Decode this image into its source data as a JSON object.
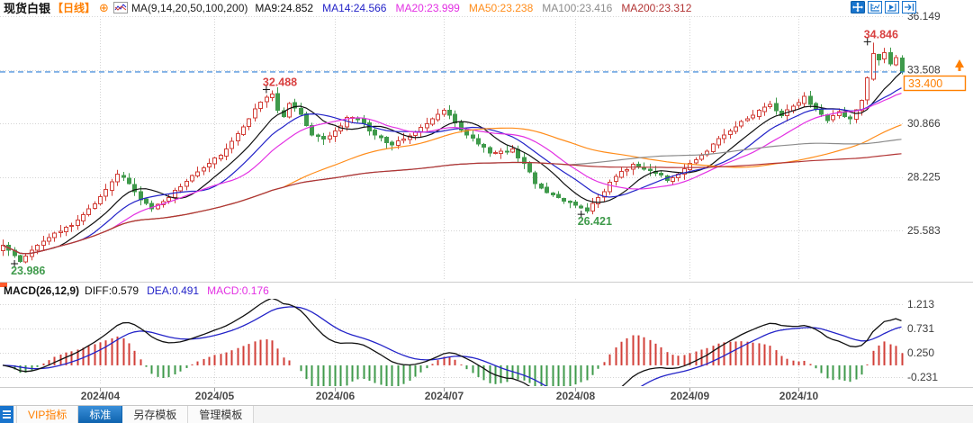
{
  "header": {
    "symbol": "现货白银",
    "period": "【日线】",
    "ma_group": "MA(9,14,20,50,100,200)",
    "ma_values": [
      {
        "key": "ma9",
        "label": "MA9:24.852"
      },
      {
        "key": "ma14",
        "label": "MA14:24.566"
      },
      {
        "key": "ma20",
        "label": "MA20:23.999"
      },
      {
        "key": "ma50",
        "label": "MA50:23.238"
      },
      {
        "key": "ma100",
        "label": "MA100:23.416"
      },
      {
        "key": "ma200",
        "label": "MA200:23.312"
      }
    ]
  },
  "macd_header": {
    "name": "MACD(26,12,9)",
    "values": [
      {
        "key": "diff",
        "label": "DIFF:0.579"
      },
      {
        "key": "dea",
        "label": "DEA:0.491"
      },
      {
        "key": "macd",
        "label": "MACD:0.176"
      }
    ]
  },
  "price_box": "33.400",
  "icons": {
    "header": [
      "target-circle-icon",
      "mini-chart-icon"
    ],
    "toolbar": [
      "move-crosshair-icon",
      "axis-left-scale-icon",
      "axis-right-scale-icon",
      "shift-right-icon"
    ],
    "tabbar": [
      "menu-grid-icon"
    ],
    "axis": [
      "up-arrow-icon"
    ]
  },
  "tabs": {
    "items": [
      {
        "label": "VIP指标",
        "style": "vip"
      },
      {
        "label": "标准",
        "active": true
      },
      {
        "label": "另存模板"
      },
      {
        "label": "管理模板"
      }
    ]
  },
  "colors": {
    "up": "#d23f38",
    "down": "#3f9a4b",
    "ma9": "#111111",
    "ma14": "#2323c8",
    "ma20": "#e331e3",
    "ma50": "#ff8c1a",
    "ma100": "#8c8c8c",
    "ma200": "#b23434",
    "diff": "#111111",
    "dea": "#2323c8",
    "macd": "#e331e3",
    "accent_orange": "#ff7f00",
    "accent_blue": "#1874cd",
    "price_line": "#2f7fd6",
    "label_red": "#d94040",
    "label_green": "#3f9a4b",
    "grid": "#d4d4d4",
    "axis_text": "#3c3c3c",
    "date_text": "#4a4a4a"
  },
  "chart_data": {
    "type": "candlestick",
    "title": "现货白银",
    "period": "日线",
    "panes": [
      "price+MA(9,14,20,50,100,200)",
      "MACD(26,12,9)"
    ],
    "days": 158,
    "y_axis_main": [
      36.149,
      33.508,
      30.866,
      28.225,
      25.583
    ],
    "y_axis_macd": [
      1.213,
      0.731,
      0.25,
      -0.231
    ],
    "x_axis": [
      {
        "label": "2024/04",
        "day": 17
      },
      {
        "label": "2024/05",
        "day": 37
      },
      {
        "label": "2024/06",
        "day": 58
      },
      {
        "label": "2024/07",
        "day": 77
      },
      {
        "label": "2024/08",
        "day": 100
      },
      {
        "label": "2024/09",
        "day": 120
      },
      {
        "label": "2024/10",
        "day": 139
      }
    ],
    "last_price": 33.4,
    "macd_last": {
      "diff": 0.579,
      "dea": 0.491,
      "macd": 0.176
    },
    "ma_periods": [
      9,
      14,
      20,
      50,
      100,
      200
    ],
    "macd_params": [
      26,
      12,
      9
    ],
    "key_points": [
      {
        "day": 3,
        "kind": "low",
        "value": 23.986
      },
      {
        "day": 47,
        "kind": "high",
        "value": 32.488
      },
      {
        "day": 102,
        "kind": "low",
        "value": 26.421
      },
      {
        "day": 152,
        "kind": "high",
        "value": 34.846
      }
    ],
    "close_waypoints": [
      [
        0,
        24.85
      ],
      [
        2,
        24.35
      ],
      [
        3,
        24.05
      ],
      [
        5,
        24.6
      ],
      [
        7,
        25.05
      ],
      [
        10,
        25.55
      ],
      [
        13,
        26.1
      ],
      [
        16,
        26.9
      ],
      [
        18,
        27.6
      ],
      [
        20,
        28.35
      ],
      [
        22,
        27.9
      ],
      [
        24,
        27.1
      ],
      [
        26,
        26.65
      ],
      [
        28,
        27.0
      ],
      [
        30,
        27.55
      ],
      [
        33,
        28.3
      ],
      [
        36,
        28.9
      ],
      [
        39,
        29.6
      ],
      [
        42,
        30.7
      ],
      [
        45,
        31.9
      ],
      [
        47,
        32.3
      ],
      [
        48,
        31.5
      ],
      [
        49,
        31.2
      ],
      [
        50,
        31.85
      ],
      [
        52,
        31.3
      ],
      [
        54,
        30.3
      ],
      [
        56,
        30.1
      ],
      [
        58,
        30.5
      ],
      [
        60,
        31.15
      ],
      [
        62,
        31.05
      ],
      [
        64,
        30.5
      ],
      [
        66,
        30.15
      ],
      [
        68,
        29.8
      ],
      [
        70,
        30.1
      ],
      [
        72,
        30.45
      ],
      [
        74,
        30.85
      ],
      [
        76,
        31.3
      ],
      [
        77,
        31.5
      ],
      [
        79,
        30.9
      ],
      [
        81,
        30.3
      ],
      [
        83,
        29.85
      ],
      [
        85,
        29.4
      ],
      [
        87,
        29.5
      ],
      [
        89,
        29.6
      ],
      [
        91,
        28.9
      ],
      [
        93,
        27.9
      ],
      [
        95,
        27.45
      ],
      [
        97,
        27.2
      ],
      [
        99,
        26.95
      ],
      [
        101,
        26.7
      ],
      [
        102,
        26.55
      ],
      [
        104,
        27.2
      ],
      [
        106,
        27.95
      ],
      [
        108,
        28.5
      ],
      [
        110,
        28.85
      ],
      [
        112,
        28.6
      ],
      [
        114,
        28.4
      ],
      [
        116,
        28.05
      ],
      [
        118,
        28.35
      ],
      [
        120,
        28.9
      ],
      [
        122,
        29.3
      ],
      [
        124,
        29.85
      ],
      [
        126,
        30.3
      ],
      [
        128,
        30.7
      ],
      [
        130,
        31.1
      ],
      [
        132,
        31.5
      ],
      [
        134,
        31.8
      ],
      [
        136,
        31.25
      ],
      [
        138,
        31.7
      ],
      [
        140,
        32.2
      ],
      [
        142,
        31.55
      ],
      [
        144,
        31.0
      ],
      [
        146,
        31.45
      ],
      [
        148,
        31.1
      ],
      [
        150,
        32.0
      ],
      [
        151,
        33.1
      ],
      [
        152,
        34.3
      ],
      [
        153,
        34.0
      ],
      [
        154,
        34.35
      ],
      [
        155,
        33.8
      ],
      [
        156,
        34.1
      ],
      [
        157,
        33.4
      ]
    ]
  }
}
